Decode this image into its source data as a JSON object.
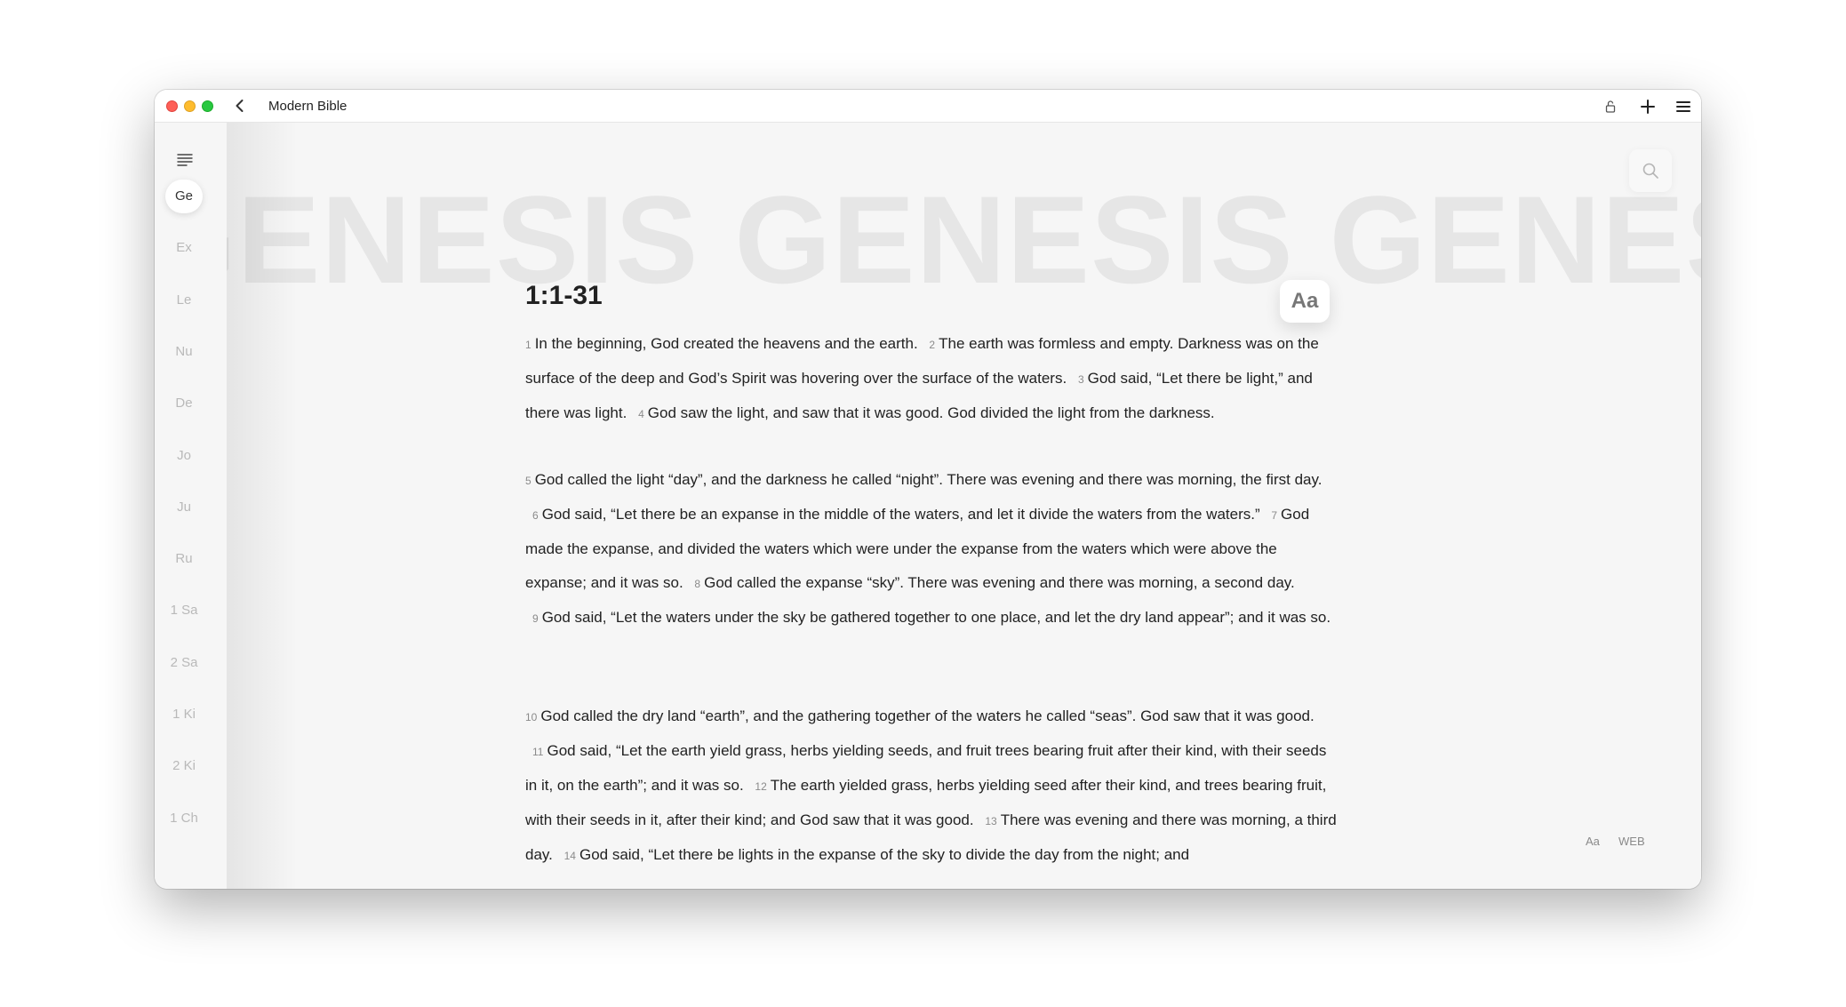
{
  "window": {
    "title": "Modern Bible"
  },
  "sidebar": {
    "books": [
      "Ge",
      "Ex",
      "Le",
      "Nu",
      "De",
      "Jo",
      "Ju",
      "Ru",
      "1 Sa",
      "2 Sa",
      "1 Ki",
      "2 Ki",
      "1 Ch"
    ],
    "active_index": 0
  },
  "content": {
    "banner_text": "GENESIS GENESIS GENESIS GENESIS",
    "reference": "1:1-31",
    "font_button_label": "Aa",
    "paragraphs": [
      [
        {
          "n": "1",
          "t": "In the beginning, God created the heavens and the earth."
        },
        {
          "n": "2",
          "t": "The earth was formless and empty. Darkness was on the surface of the deep and God’s Spirit was hovering over the surface of the waters."
        },
        {
          "n": "3",
          "t": "God said, “Let there be light,” and there was light."
        },
        {
          "n": "4",
          "t": "God saw the light, and saw that it was good. God divided the light from the darkness."
        }
      ],
      [
        {
          "n": "5",
          "t": "God called the light “day”, and the darkness he called “night”. There was evening and there was morning, the first day."
        },
        {
          "n": "6",
          "t": "God said, “Let there be an expanse in the middle of the waters, and let it divide the waters from the waters.”"
        },
        {
          "n": "7",
          "t": "God made the expanse, and divided the waters which were under the expanse from the waters which were above the expanse; and it was so."
        },
        {
          "n": "8",
          "t": "God called the expanse “sky”. There was evening and there was morning, a second day."
        },
        {
          "n": "9",
          "t": "God said, “Let the waters under the sky be gathered together to one place, and let the dry land appear”; and it was so."
        }
      ],
      [
        {
          "n": "10",
          "t": "God called the dry land “earth”, and the gathering together of the waters he called “seas”. God saw that it was good."
        },
        {
          "n": "11",
          "t": "God said, “Let the earth yield grass, herbs yielding seeds, and fruit trees bearing fruit after their kind, with their seeds in it, on the earth”; and it was so."
        },
        {
          "n": "12",
          "t": "The earth yielded grass, herbs yielding seed after their kind, and trees bearing fruit, with their seeds in it, after their kind; and God saw that it was good."
        },
        {
          "n": "13",
          "t": "There was evening and there was morning, a third day."
        },
        {
          "n": "14",
          "t": "God said, “Let there be lights in the expanse of the sky to divide the day from the night; and"
        }
      ]
    ]
  },
  "footer": {
    "font_label": "Aa",
    "translation_label": "WEB"
  }
}
